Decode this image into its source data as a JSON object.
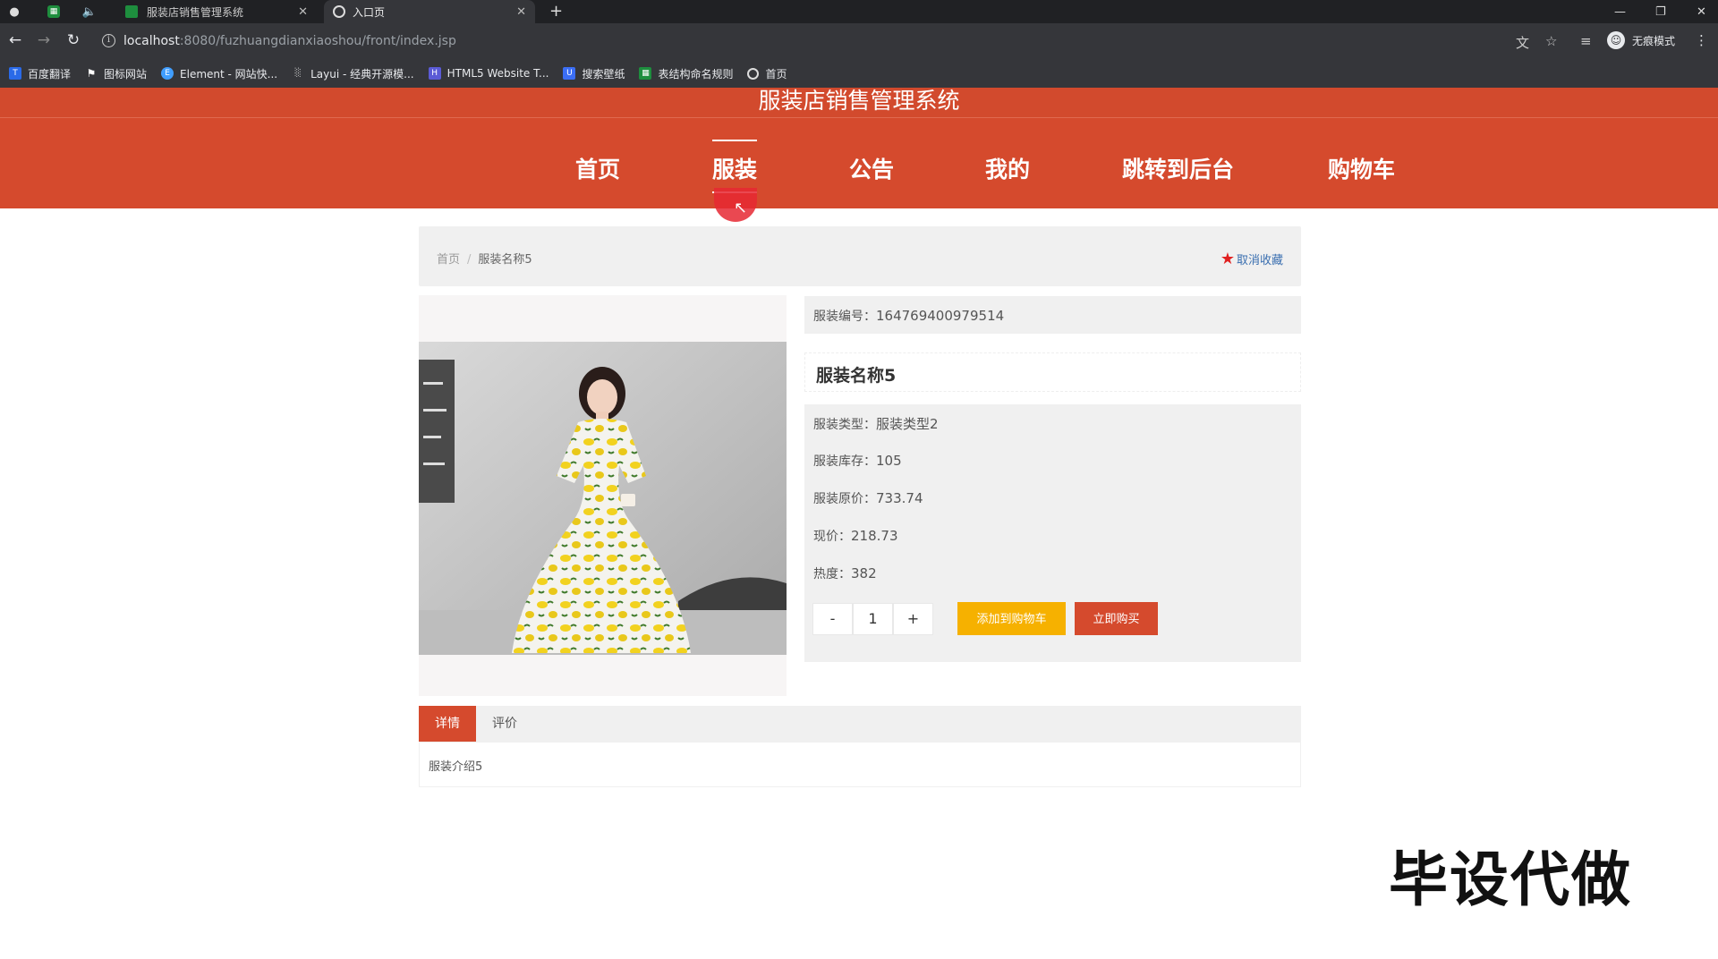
{
  "browser": {
    "tabs": [
      {
        "label": "服装店销售管理系统"
      },
      {
        "label": "入口页"
      }
    ],
    "url_host": "localhost",
    "url_rest": ":8080/fuzhuangdianxiaoshou/front/index.jsp",
    "profile_label": "无痕模式",
    "bookmarks": [
      {
        "label": "百度翻译",
        "color": "#2a6ae8"
      },
      {
        "label": "图标网站",
        "color": "#35363a"
      },
      {
        "label": "Element - 网站快...",
        "color": "#409eff"
      },
      {
        "label": "Layui - 经典开源模...",
        "color": "#35363a"
      },
      {
        "label": "HTML5 Website T...",
        "color": "#5b5bd6"
      },
      {
        "label": "搜索壁纸",
        "color": "#3b6ef5"
      },
      {
        "label": "表结构命名规则",
        "color": "#1e8e3e"
      },
      {
        "label": "首页",
        "color": "#35363a"
      }
    ]
  },
  "site": {
    "title": "服装店销售管理系统",
    "nav": [
      {
        "label": "首页"
      },
      {
        "label": "服装"
      },
      {
        "label": "公告"
      },
      {
        "label": "我的"
      },
      {
        "label": "跳转到后台"
      },
      {
        "label": "购物车"
      }
    ],
    "active_nav": "服装",
    "accent": "#d54a2d"
  },
  "breadcrumb": {
    "home": "首页",
    "sep": "/",
    "current": "服装名称5"
  },
  "favorite": {
    "label": "取消收藏"
  },
  "product": {
    "code_label": "服装编号：",
    "code_value": "164769400979514",
    "name": "服装名称5",
    "type_label": "服装类型：",
    "type_value": "服装类型2",
    "stock_label": "服装库存：",
    "stock_value": "105",
    "orig_price_label": "服装原价：",
    "orig_price_value": "733.74",
    "price_label": "现价：",
    "price_value": "218.73",
    "heat_label": "热度：",
    "heat_value": "382",
    "qty_minus": "-",
    "qty_value": "1",
    "qty_plus": "+",
    "add_cart": "添加到购物车",
    "buy_now": "立即购买"
  },
  "tabs": {
    "details": "详情",
    "reviews": "评价",
    "content": "服装介绍5"
  },
  "watermark": "毕设代做"
}
